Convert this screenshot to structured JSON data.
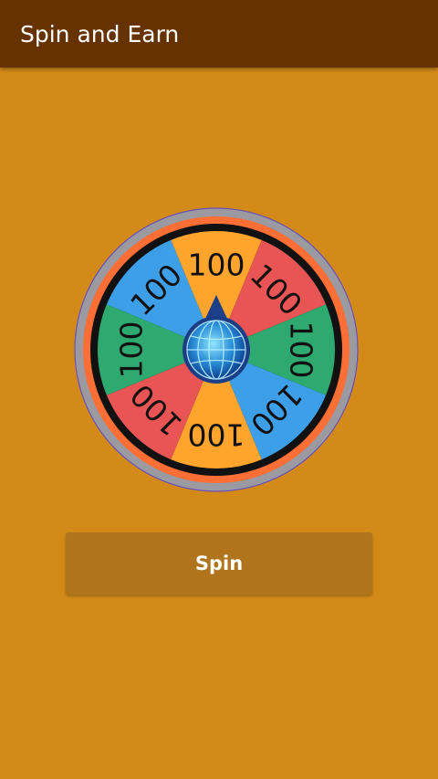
{
  "app_bar": {
    "title": "Spin and Earn",
    "color": "#663300"
  },
  "background_color": "#D48A18",
  "wheel": {
    "segments": [
      {
        "label": "100",
        "color": "#FFA52E"
      },
      {
        "label": "100",
        "color": "#E95454"
      },
      {
        "label": "100",
        "color": "#2EAA71"
      },
      {
        "label": "100",
        "color": "#3E9FE9"
      },
      {
        "label": "100",
        "color": "#FFA52E"
      },
      {
        "label": "100",
        "color": "#E95454"
      },
      {
        "label": "100",
        "color": "#2EAA71"
      },
      {
        "label": "100",
        "color": "#3E9FE9"
      }
    ],
    "center_icon": "globe-icon",
    "pointer_icon": "pointer-arrow-icon"
  },
  "spin_button": {
    "label": "Spin",
    "color": "#B0741C"
  }
}
